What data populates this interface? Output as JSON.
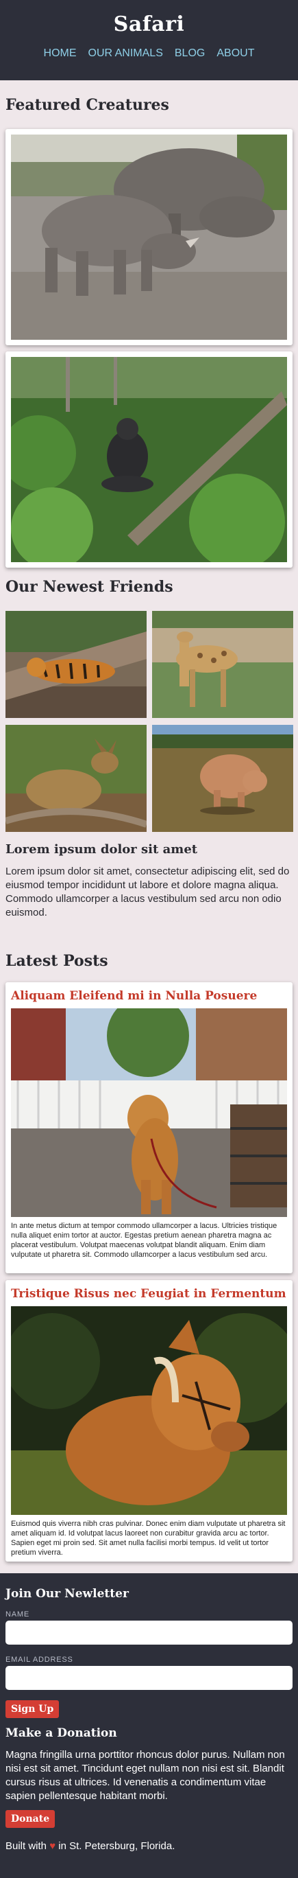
{
  "header": {
    "title": "Safari",
    "nav": [
      "HOME",
      "OUR ANIMALS",
      "BLOG",
      "ABOUT"
    ]
  },
  "featured": {
    "title": "Featured Creatures"
  },
  "friends": {
    "title": "Our Newest Friends",
    "subtitle": "Lorem ipsum dolor sit amet",
    "text": "Lorem ipsum dolor sit amet, consectetur adipiscing elit, sed do eiusmod tempor incididunt ut labore et dolore magna aliqua. Commodo ullamcorper a lacus vestibulum sed arcu non odio euismod."
  },
  "posts": {
    "title": "Latest Posts",
    "items": [
      {
        "title": "Aliquam Eleifend mi in Nulla Posuere",
        "text": "In ante metus dictum at tempor commodo ullamcorper a lacus. Ultricies tristique nulla aliquet enim tortor at auctor. Egestas pretium aenean pharetra magna ac placerat vestibulum. Volutpat maecenas volutpat blandit aliquam. Enim diam vulputate ut pharetra sit. Commodo ullamcorper a lacus vestibulum sed arcu."
      },
      {
        "title": "Tristique Risus nec Feugiat in Fermentum",
        "text": "Euismod quis viverra nibh cras pulvinar. Donec enim diam vulputate ut pharetra sit amet aliquam id. Id volutpat lacus laoreet non curabitur gravida arcu ac tortor. Sapien eget mi proin sed. Sit amet nulla facilisi morbi tempus. Id velit ut tortor pretium viverra."
      }
    ]
  },
  "footer": {
    "newsletter_title": "Join Our Newletter",
    "name_label": "NAME",
    "email_label": "EMAIL ADDRESS",
    "signup_label": "Sign Up",
    "donation_title": "Make a Donation",
    "donation_text": "Magna fringilla urna porttitor rhoncus dolor purus. Nullam non nisi est sit amet. Tincidunt eget nullam non nisi est sit. Blandit cursus risus at ultrices. Id venenatis a condimentum vitae sapien pellentesque habitant morbi.",
    "donate_label": "Donate",
    "built_prefix": "Built with",
    "built_suffix": "in St. Petersburg, Florida."
  },
  "colors": {
    "header_bg": "#2d2f3a",
    "page_bg": "#efe7ea",
    "accent_red": "#d43e34",
    "nav_link": "#8fd0e8"
  }
}
